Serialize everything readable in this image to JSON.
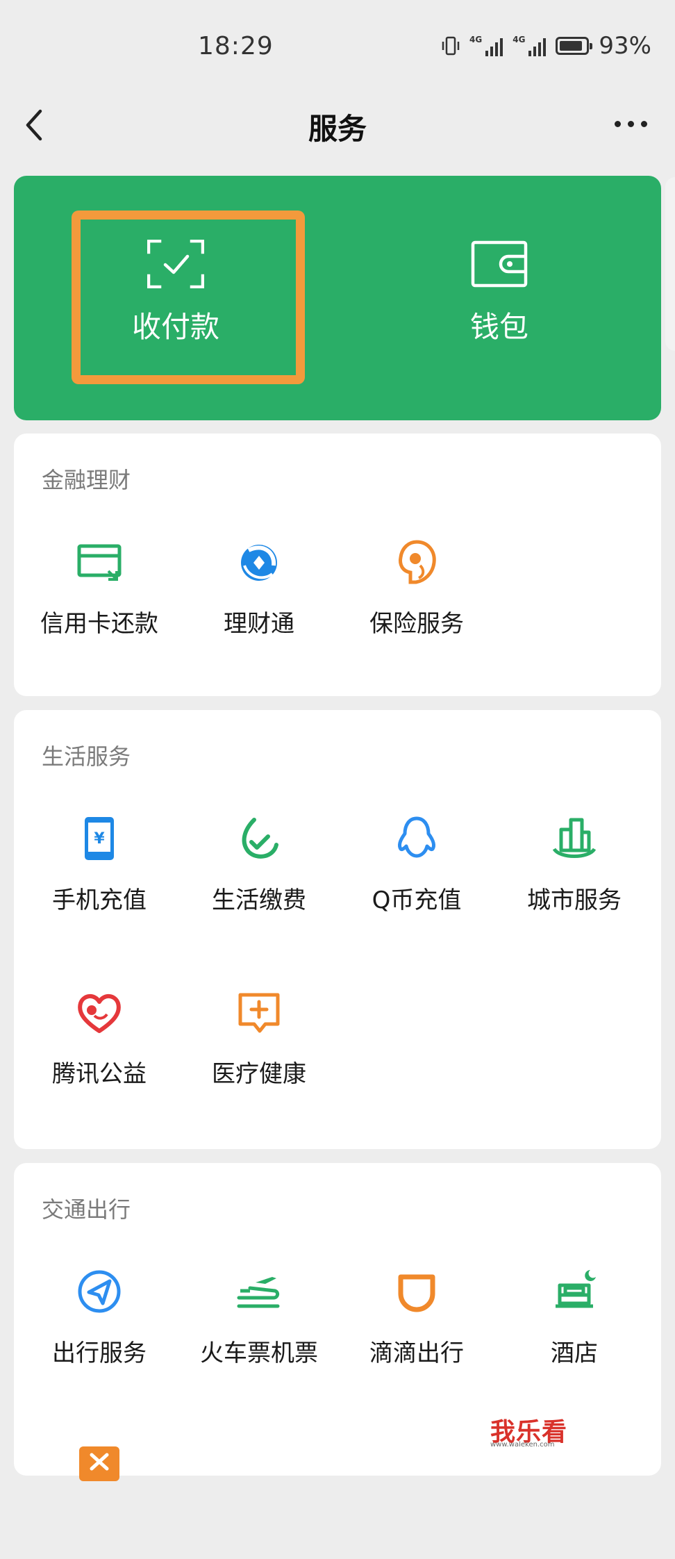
{
  "status_bar": {
    "time": "18:29",
    "battery": "93%",
    "network_1": "4G",
    "network_2": "4G"
  },
  "nav": {
    "title": "服务"
  },
  "wallet": {
    "pay_label": "收付款",
    "wallet_label": "钱包",
    "accent": "#2aae67",
    "highlight_color": "#f39a3c"
  },
  "finance": {
    "title": "金融理财",
    "items": [
      {
        "label": "信用卡还款",
        "icon": "credit-card-icon",
        "color": "#2aae67"
      },
      {
        "label": "理财通",
        "icon": "wealth-icon",
        "color": "#1e88e5"
      },
      {
        "label": "保险服务",
        "icon": "insurance-icon",
        "color": "#f0892b"
      }
    ]
  },
  "life": {
    "title": "生活服务",
    "items": [
      {
        "label": "手机充值",
        "icon": "phone-topup-icon",
        "color": "#1e88e5"
      },
      {
        "label": "生活缴费",
        "icon": "utility-icon",
        "color": "#2aae67"
      },
      {
        "label": "Q币充值",
        "icon": "qq-penguin-icon",
        "color": "#2d8ef0"
      },
      {
        "label": "城市服务",
        "icon": "city-icon",
        "color": "#2aae67"
      },
      {
        "label": "腾讯公益",
        "icon": "charity-heart-icon",
        "color": "#e5383b"
      },
      {
        "label": "医疗健康",
        "icon": "medical-icon",
        "color": "#f0892b"
      }
    ]
  },
  "transport": {
    "title": "交通出行",
    "items": [
      {
        "label": "出行服务",
        "icon": "navigation-icon",
        "color": "#2d8ef0"
      },
      {
        "label": "火车票机票",
        "icon": "train-plane-icon",
        "color": "#2aae67"
      },
      {
        "label": "滴滴出行",
        "icon": "didi-icon",
        "color": "#f0892b"
      },
      {
        "label": "酒店",
        "icon": "hotel-icon",
        "color": "#2aae67"
      }
    ]
  },
  "watermark": {
    "text": "我乐看",
    "sub": "www.waleken.com"
  }
}
